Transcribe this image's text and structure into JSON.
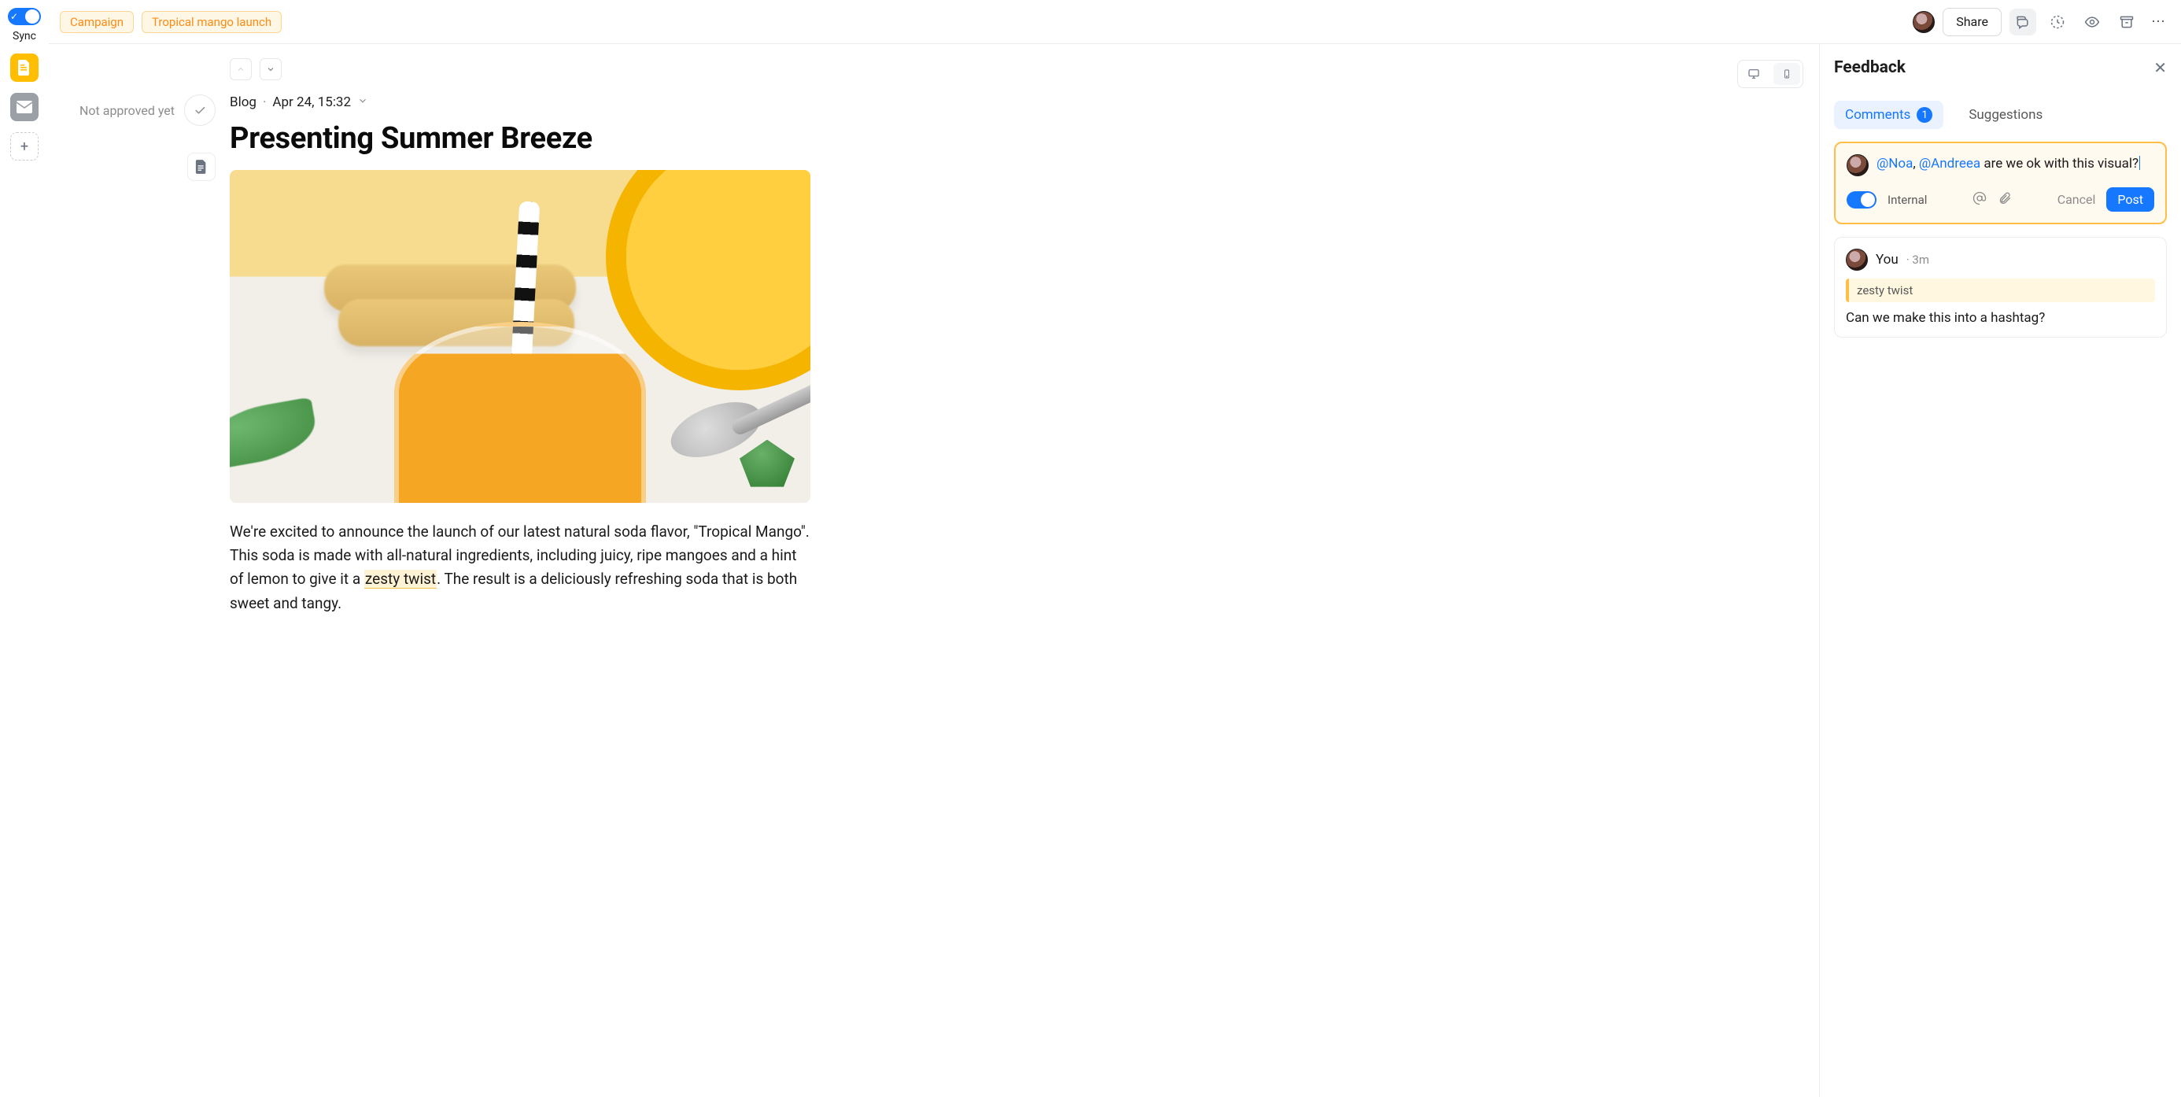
{
  "rail": {
    "sync_label": "Sync",
    "add_glyph": "+"
  },
  "topbar": {
    "tags": [
      "Campaign",
      "Tropical mango launch"
    ],
    "share_label": "Share",
    "more_glyph": "⋯"
  },
  "approval": {
    "status_text": "Not approved yet"
  },
  "doc": {
    "type_label": "Blog",
    "date_label": "Apr 24, 15:32",
    "separator": "·",
    "title": "Presenting Summer Breeze",
    "body_pre": "We're excited to announce the launch of our latest natural soda flavor, \"Tropical Mango\". This soda is made with all-natural ingredients, including juicy, ripe mangoes and a hint of lemon to give it a ",
    "body_highlight": "zesty twist",
    "body_post": ". The result is a deliciously refreshing soda that is both sweet and tangy."
  },
  "feedback": {
    "panel_title": "Feedback",
    "tabs": {
      "comments_label": "Comments",
      "comments_count": "1",
      "suggestions_label": "Suggestions"
    },
    "composer": {
      "mentions": [
        "@Noa",
        "@Andreea"
      ],
      "mention_sep": ", ",
      "text_after": " are we ok with this visual?",
      "internal_label": "Internal",
      "cancel_label": "Cancel",
      "post_label": "Post"
    },
    "comment": {
      "author": "You",
      "time_prefix": "· ",
      "time": "3m",
      "quote": "zesty twist",
      "body": "Can we make this into a hashtag?"
    }
  }
}
